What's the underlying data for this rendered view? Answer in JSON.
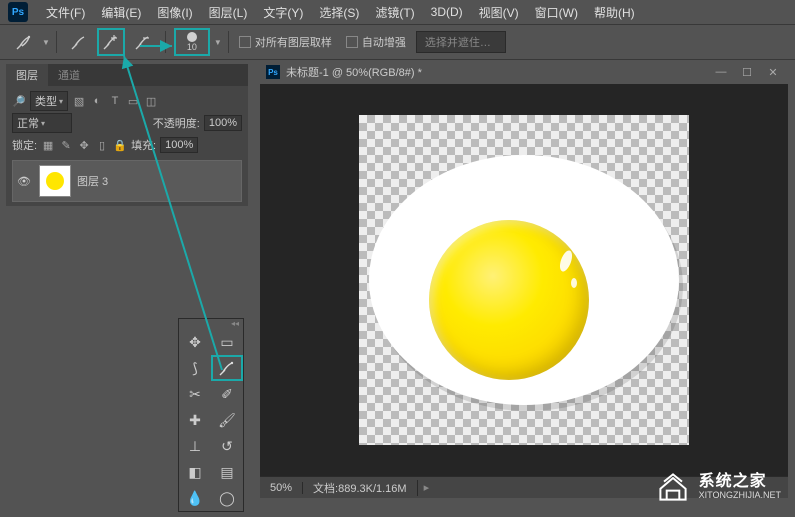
{
  "menu": {
    "file": "文件(F)",
    "edit": "编辑(E)",
    "image": "图像(I)",
    "layer": "图层(L)",
    "text": "文字(Y)",
    "select": "选择(S)",
    "filter": "滤镜(T)",
    "threeD": "3D(D)",
    "view": "视图(V)",
    "window": "窗口(W)",
    "help": "帮助(H)"
  },
  "optbar": {
    "brush_size": "10",
    "sample_all": "对所有图层取样",
    "auto_enhance": "自动增强",
    "refine": "选择并遮住…"
  },
  "layers_panel": {
    "tab_layers": "图层",
    "tab_channels": "通道",
    "filter_label": "类型",
    "blend_mode": "正常",
    "opacity_label": "不透明度:",
    "opacity_value": "100%",
    "lock_label": "锁定:",
    "fill_label": "填充:",
    "fill_value": "100%",
    "layer_name": "图层 3"
  },
  "document": {
    "title": "未标题-1 @ 50%(RGB/8#) *",
    "zoom": "50%",
    "docsize": "文档:889.3K/1.16M"
  },
  "watermark": {
    "cn": "系统之家",
    "en": "XITONGZHIJIA.NET"
  }
}
